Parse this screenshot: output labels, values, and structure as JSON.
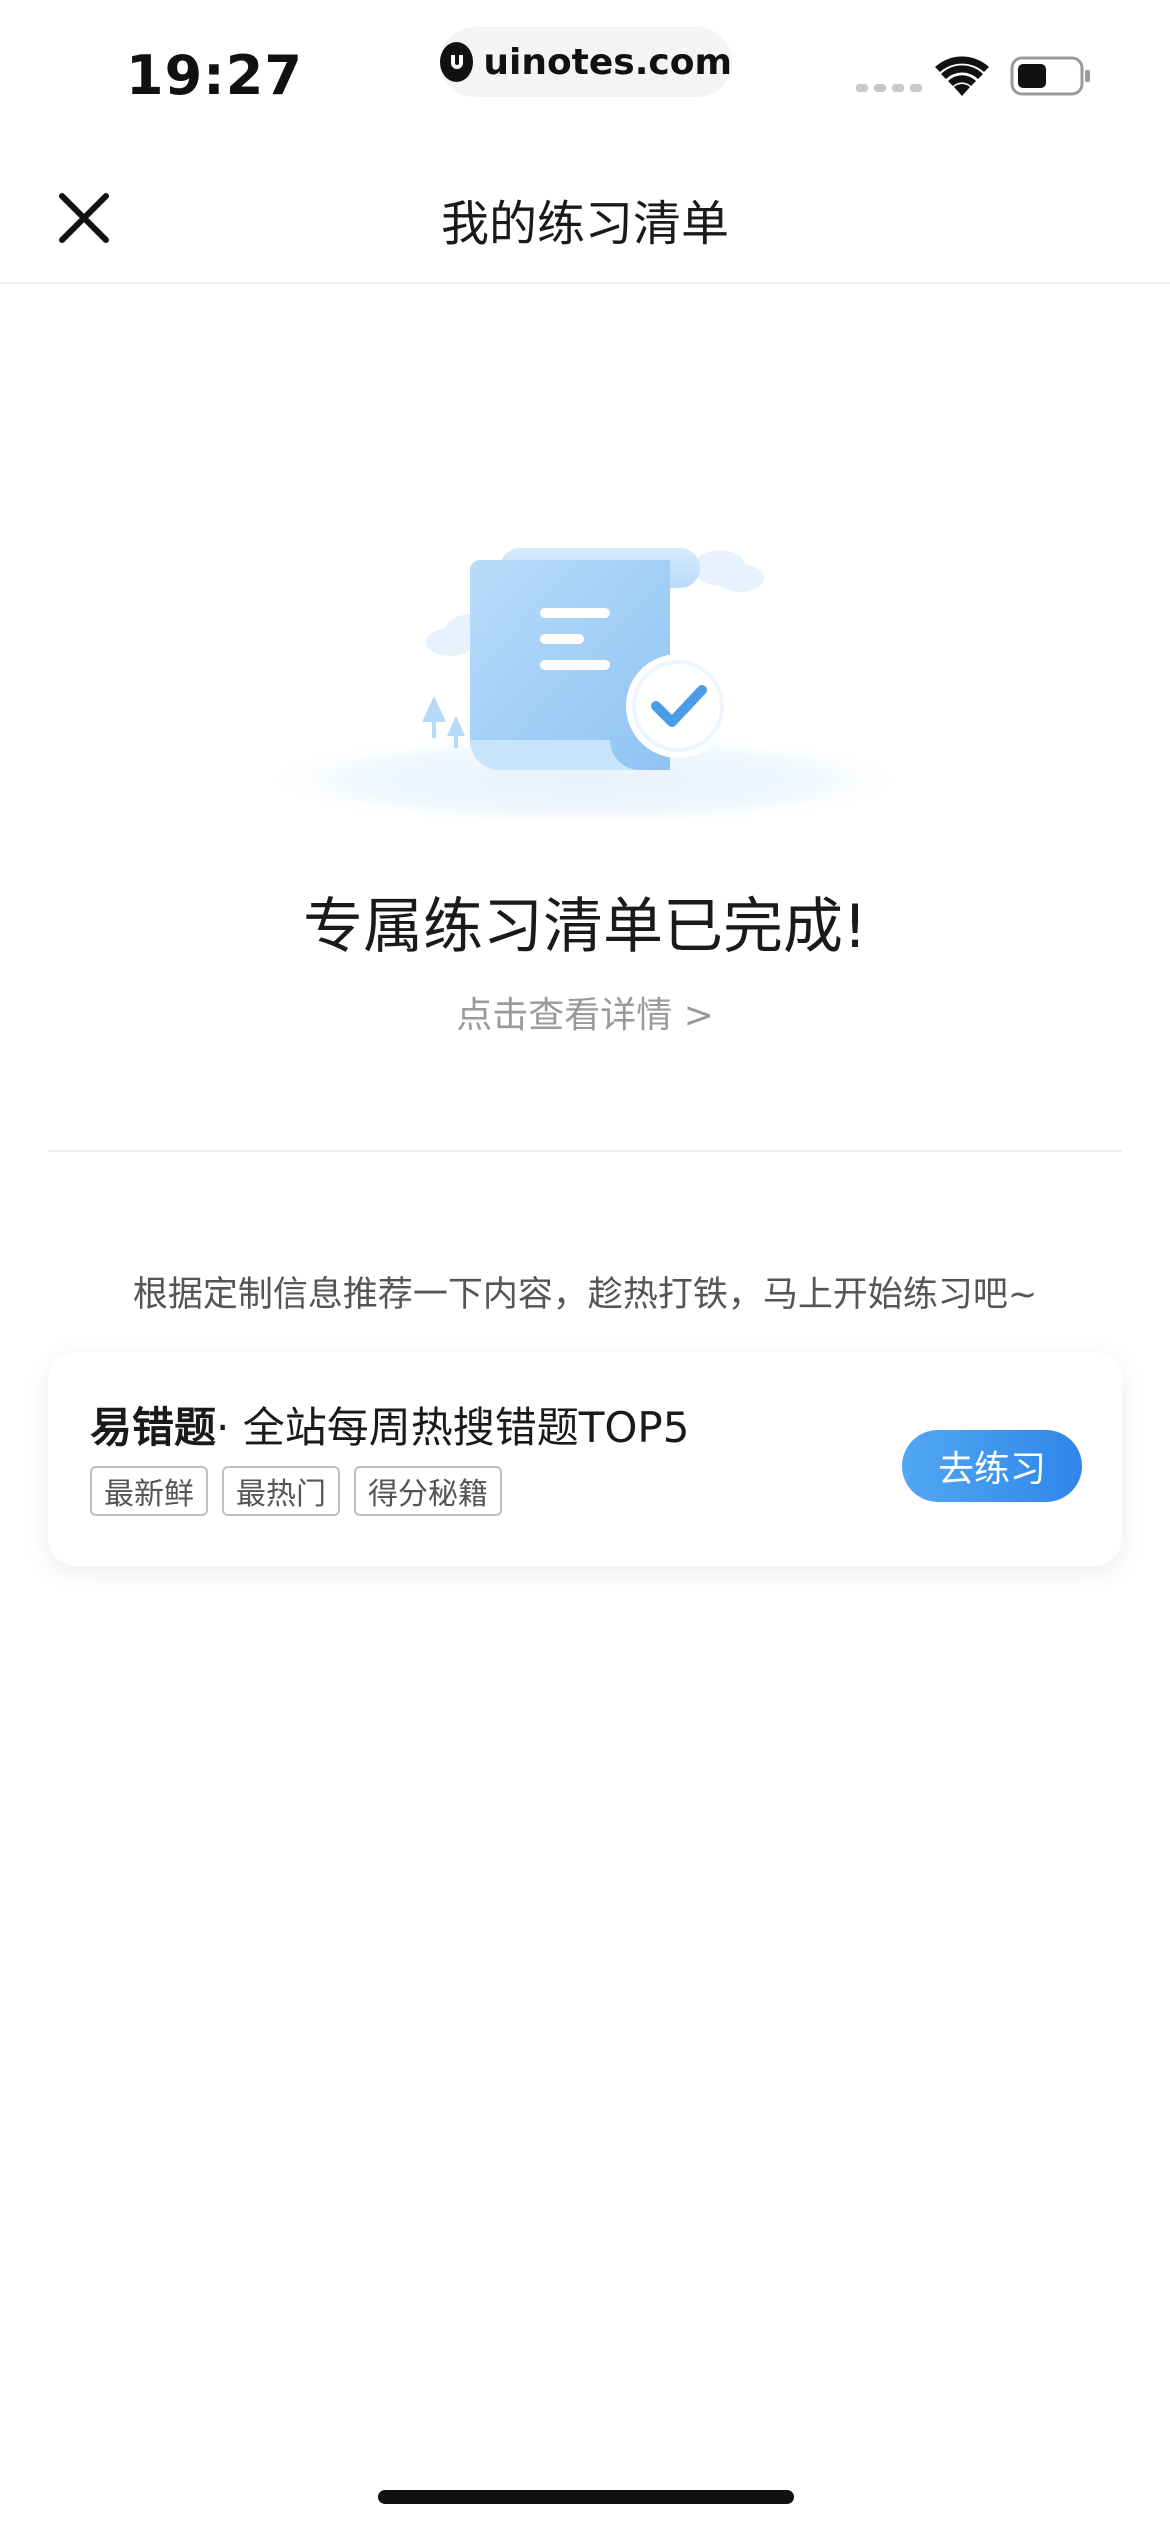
{
  "status_bar": {
    "time": "19:27",
    "url": "uinotes.com"
  },
  "nav": {
    "title": "我的练习清单"
  },
  "result": {
    "title": "专属练习清单已完成!",
    "detail_link": "点击查看详情 >"
  },
  "recommend": {
    "text": "根据定制信息推荐一下内容，趁热打铁，马上开始练习吧~"
  },
  "card": {
    "title_bold": "易错题",
    "title_rest": "· 全站每周热搜错题TOP5",
    "tags": [
      "最新鲜",
      "最热门",
      "得分秘籍"
    ],
    "button_label": "去练习"
  },
  "colors": {
    "accent": "#3b8fec",
    "illustration_blue": "#a9d4f8",
    "check_blue": "#4a9be8"
  },
  "icons": {
    "close": "close-icon",
    "wifi": "wifi-icon",
    "battery": "battery-icon",
    "signal": "signal-icon",
    "logo": "uinotes-logo-icon",
    "checklist": "checklist-illustration"
  }
}
